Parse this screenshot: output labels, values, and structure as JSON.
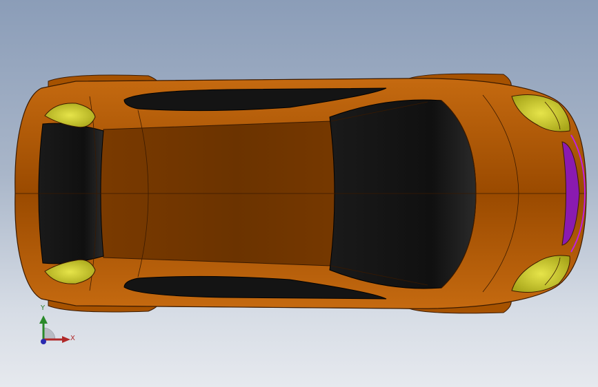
{
  "viewport": {
    "background_top": "#8b9db8",
    "background_bottom": "#e6e9ee"
  },
  "model": {
    "name": "car-body-top-view",
    "colors": {
      "body": "#b35a00",
      "body_dark": "#7a3a00",
      "edge": "#3a1a00",
      "glass": "#121212",
      "headlight": "#d7d52a",
      "taillight_strip": "#8a1ab0"
    }
  },
  "triad": {
    "x_label": "X",
    "y_label": "Y",
    "x_color": "#b02828",
    "y_color": "#2a8a2a",
    "z_color": "#2a2ab0",
    "icon": "coordinate-triad-icon"
  }
}
